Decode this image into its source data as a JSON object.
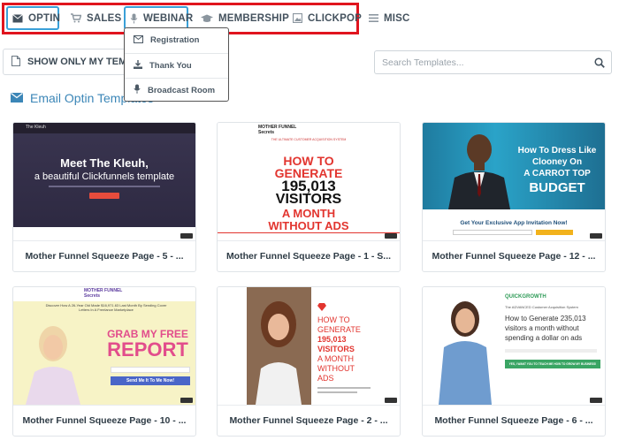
{
  "nav": {
    "items": [
      {
        "label": "OPTIN",
        "icon": "envelope-icon"
      },
      {
        "label": "SALES",
        "icon": "cart-icon"
      },
      {
        "label": "WEBINAR",
        "icon": "microphone-icon"
      },
      {
        "label": "MEMBERSHIP",
        "icon": "graduation-cap-icon"
      },
      {
        "label": "CLICKPOP",
        "icon": "picture-icon"
      },
      {
        "label": "MISC",
        "icon": "list-icon"
      }
    ],
    "active": "WEBINAR",
    "highlight_color": "#e0141e",
    "active_color": "#3aa0d8"
  },
  "dropdown": {
    "items": [
      {
        "label": "Registration",
        "icon": "envelope-icon"
      },
      {
        "label": "Thank You",
        "icon": "download-icon"
      },
      {
        "label": "Broadcast Room",
        "icon": "microphone-icon"
      }
    ]
  },
  "filter": {
    "label": "SHOW ONLY MY TEMPLATES"
  },
  "search": {
    "placeholder": "Search Templates..."
  },
  "section": {
    "title": "Email Optin Templates",
    "color": "#3b86b7"
  },
  "cards": [
    {
      "title": "Mother Funnel Squeeze Page - 5 - ...",
      "thumb": {
        "logo": "The Kleuh",
        "headline1": "Meet The Kleuh,",
        "headline2": "a beautiful Clickfunnels template"
      }
    },
    {
      "title": "Mother Funnel Squeeze Page - 1 - S...",
      "thumb": {
        "brand": "MOTHER FUNNEL Secrets",
        "kicker": "THE ULTIMATE CUSTOMER ACQUISITION SYSTEM",
        "l1": "HOW TO",
        "l2": "GENERATE",
        "l3": "195,013",
        "l4": "VISITORS",
        "l5": "A MONTH",
        "l6": "WITHOUT ADS"
      }
    },
    {
      "title": "Mother Funnel Squeeze Page - 12 - ...",
      "thumb": {
        "l1": "How To Dress Like",
        "l2": "Clooney On",
        "l3": "A CARROT TOP",
        "l4": "BUDGET",
        "cta": "Get Your Exclusive App Invitation Now!"
      }
    },
    {
      "title": "Mother Funnel Squeeze Page - 10 - ...",
      "thumb": {
        "brand": "MOTHER FUNNEL Secrets",
        "sub": "Discover How A 26-Year Old Made $16,971.63 Last Month By Sending Cover Letters In A Freelance Marketplace",
        "l1": "GRAB MY FREE",
        "l2": "REPORT",
        "cta": "Send Me It To Me Now!"
      }
    },
    {
      "title": "Mother Funnel Squeeze Page - 2 - ...",
      "thumb": {
        "l1": "HOW TO",
        "l2": "GENERATE",
        "l3": "195,013",
        "l4": "VISITORS",
        "l5": "A MONTH",
        "l6": "WITHOUT",
        "l7": "ADS"
      }
    },
    {
      "title": "Mother Funnel Squeeze Page - 6 - ...",
      "thumb": {
        "brand": "QUICKGROWTH",
        "sub": "The ADVANCED Customer Acquisition System",
        "l1": "How to Generate 235,013",
        "l2": "visitors a month without",
        "l3": "spending a dollar on ads",
        "cta": "YES, I WANT YOU TO TEACH ME HOW TO GROW MY BUSINESS!"
      }
    }
  ]
}
